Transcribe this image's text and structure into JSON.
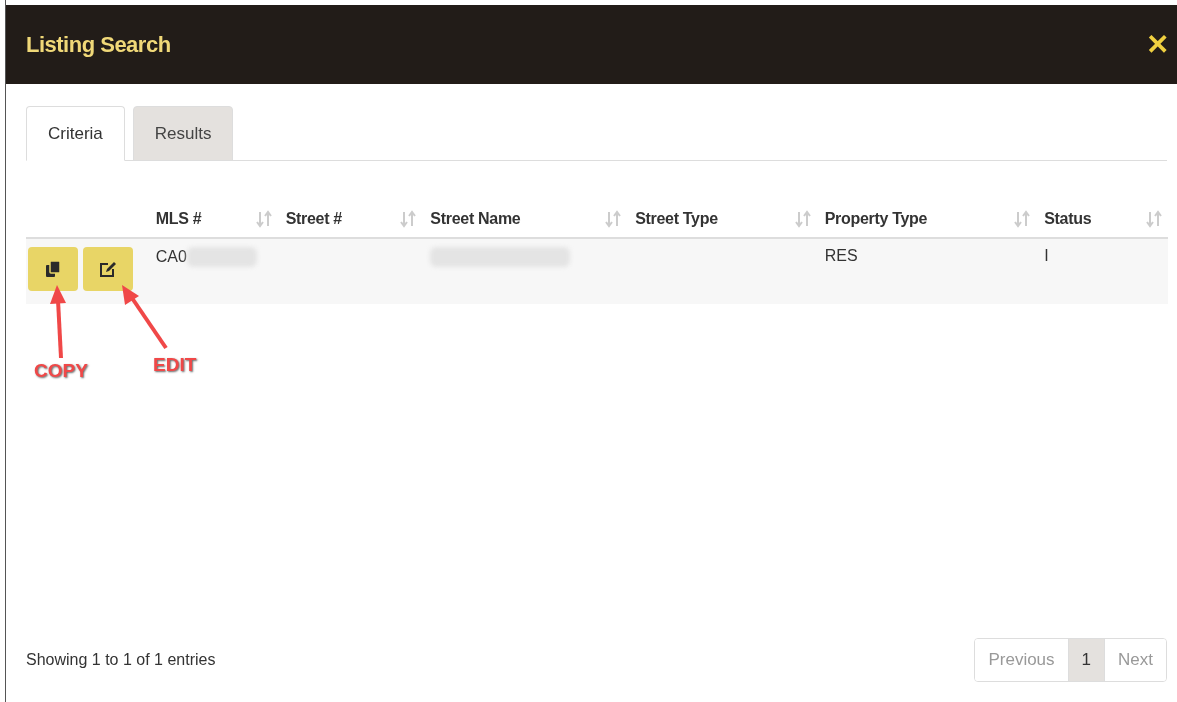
{
  "window": {
    "title": "Listing Search",
    "close": "✕"
  },
  "tabs": [
    {
      "label": "Criteria",
      "selected": true
    },
    {
      "label": "Results",
      "selected": false
    }
  ],
  "table": {
    "columns": [
      "MLS #",
      "Street #",
      "Street Name",
      "Street Type",
      "Property Type",
      "Status"
    ],
    "rows": [
      {
        "cells": [
          {
            "text": "CA0",
            "redacted": true
          },
          {
            "text": "",
            "redacted": false
          },
          {
            "text": "",
            "redacted": true
          },
          {
            "text": "",
            "redacted": false
          },
          {
            "text": "RES",
            "redacted": false
          },
          {
            "text": "I",
            "redacted": false
          }
        ]
      }
    ]
  },
  "annotations": [
    {
      "label": "COPY"
    },
    {
      "label": "EDIT"
    }
  ],
  "footer": {
    "info": "Showing 1 to 1 of 1 entries",
    "pagination": [
      {
        "label": "Previous",
        "selected": false,
        "disabled": true
      },
      {
        "label": "1",
        "selected": true,
        "disabled": false
      },
      {
        "label": "Next",
        "selected": false,
        "disabled": true
      }
    ]
  }
}
